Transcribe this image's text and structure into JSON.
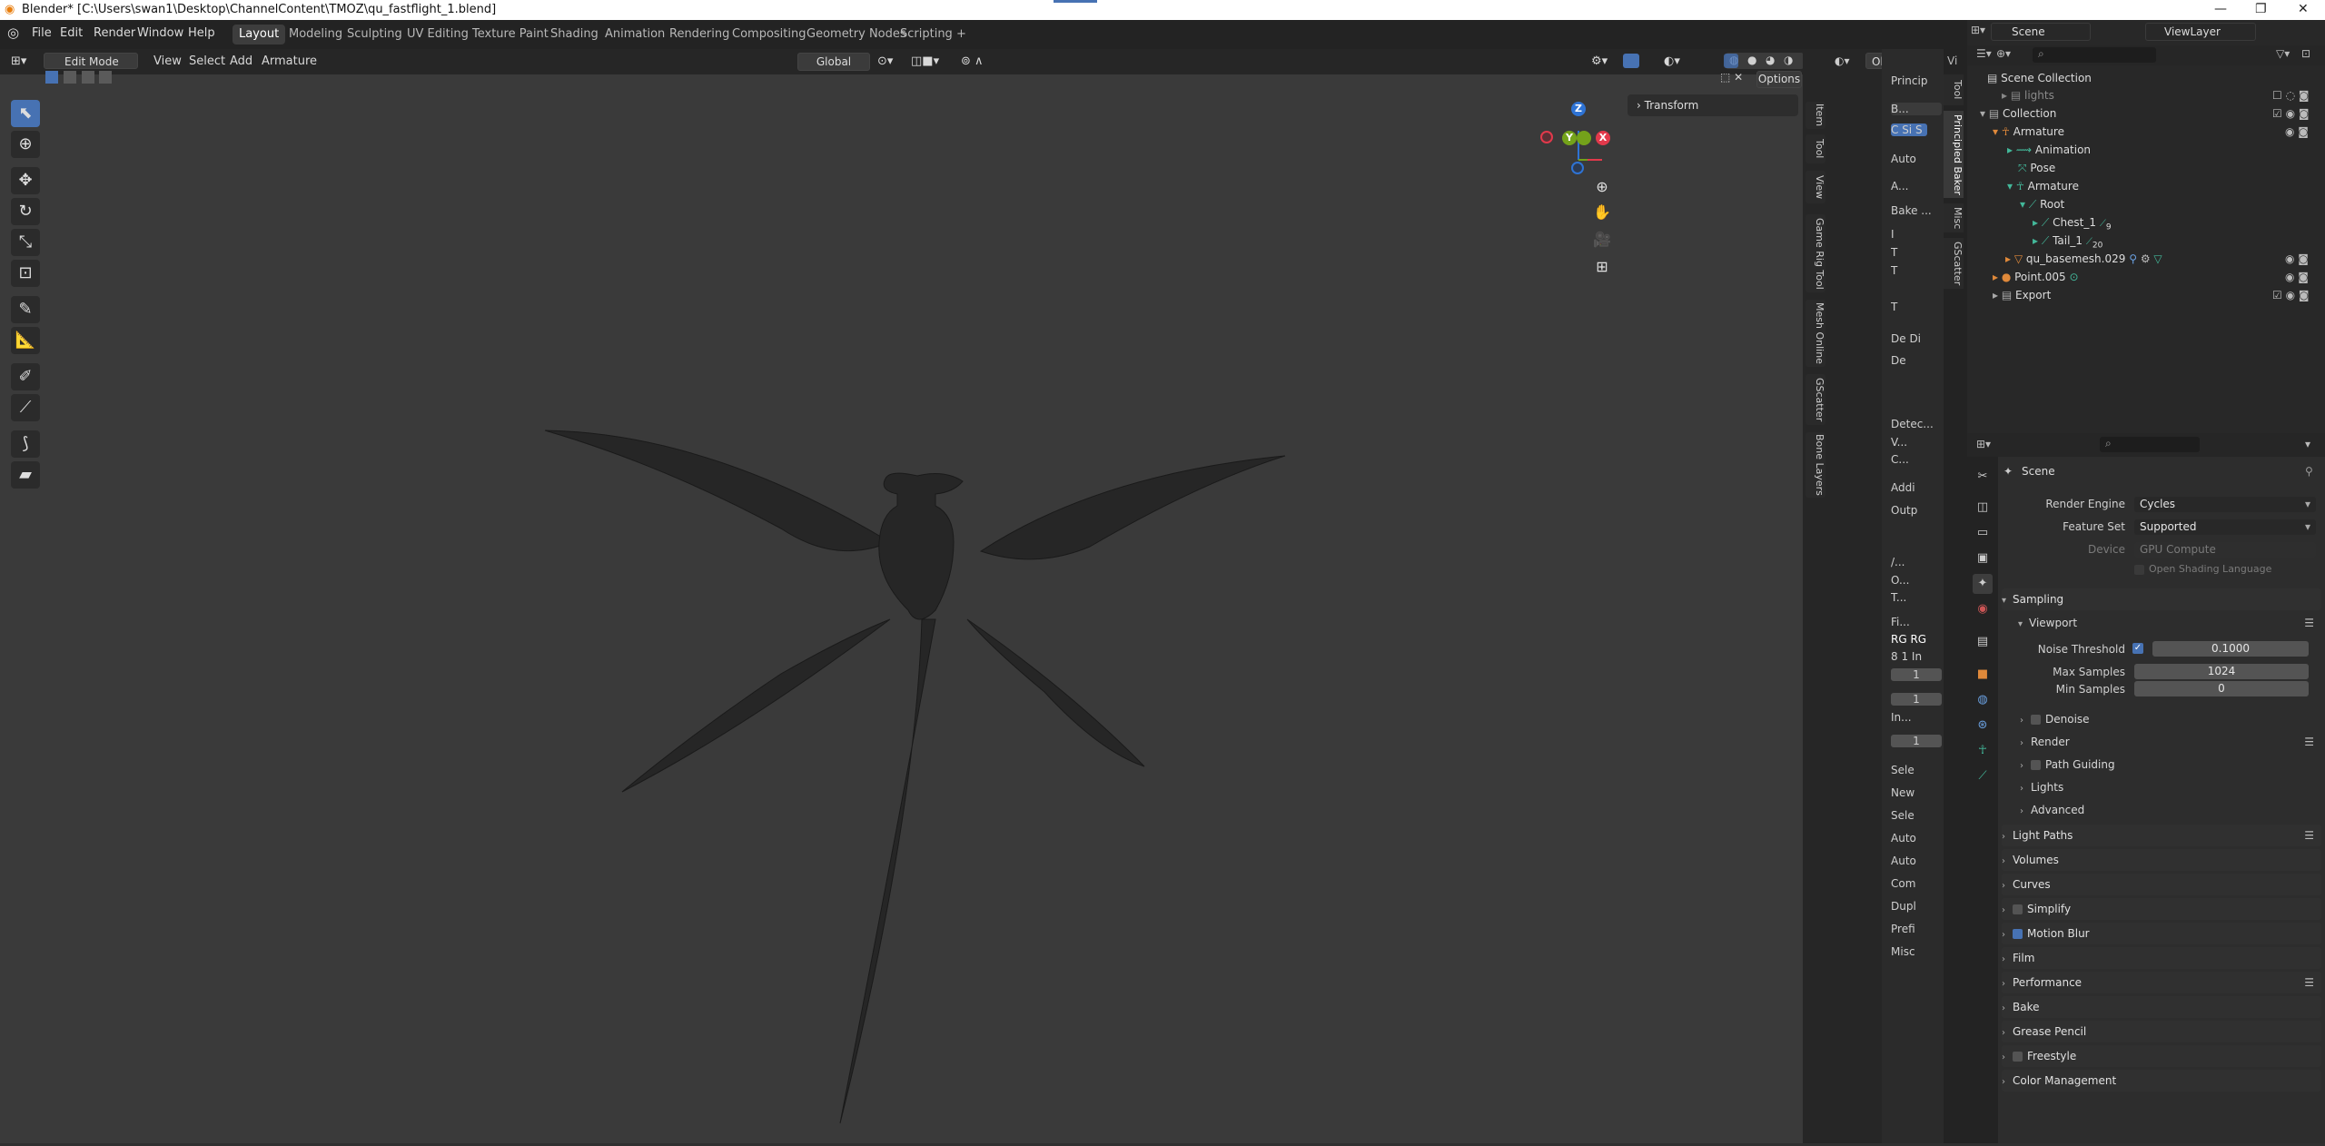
{
  "title_bar": {
    "text": "Blender* [C:\\Users\\swan1\\Desktop\\ChannelContent\\TMOZ\\qu_fastflight_1.blend]",
    "minimize": "—",
    "maximize": "❐",
    "close": "✕"
  },
  "menu": {
    "items": [
      "File",
      "Edit",
      "Render",
      "Window",
      "Help"
    ]
  },
  "workspaces": {
    "tabs": [
      "Layout",
      "Modeling",
      "Sculpting",
      "UV Editing",
      "Texture Paint",
      "Shading",
      "Animation",
      "Rendering",
      "Compositing",
      "Geometry Nodes",
      "Scripting"
    ],
    "active": "Layout",
    "add": "+"
  },
  "viewport_header": {
    "mode": "Edit Mode",
    "menus": [
      "View",
      "Select",
      "Add",
      "Armature"
    ],
    "orientation": "Global",
    "options": "Options",
    "object": "Object",
    "vi": "Vi"
  },
  "gizmo": {
    "z": "Z",
    "y": "Y",
    "x": "X"
  },
  "npanel": {
    "transform": "Transform",
    "tabs": [
      "Item",
      "Tool",
      "View",
      "Game Rig Tool",
      "Mesh Online",
      "GScatter",
      "Bone Layers"
    ]
  },
  "mid_tabs": [
    "Tool",
    "Principled Baker",
    "Misc",
    "GScatter"
  ],
  "baker": {
    "rows": [
      "Princip",
      "B...",
      "C  Si  S",
      "Auto",
      "A...",
      "Bake ...",
      "I",
      "T",
      "T",
      "T",
      "De  Di",
      "De",
      "Detec...",
      "V...",
      "C...",
      "Addi",
      "Outp",
      "/...",
      "O...",
      "T...",
      "Fi...",
      "RG  RG",
      "8  1  In",
      "1",
      "1",
      "In...",
      "1",
      "Sele",
      "New",
      "Sele",
      "Auto",
      "Auto",
      "Com",
      "Dupl",
      "Prefi",
      "Misc"
    ]
  },
  "outliner": {
    "scene": "Scene",
    "viewlayer": "ViewLayer",
    "rows": [
      {
        "label": "Scene Collection"
      },
      {
        "label": "lights"
      },
      {
        "label": "Collection"
      },
      {
        "label": "Armature"
      },
      {
        "label": "Animation"
      },
      {
        "label": "Pose"
      },
      {
        "label": "Armature"
      },
      {
        "label": "Root"
      },
      {
        "label": "Chest_1",
        "badge": "9"
      },
      {
        "label": "Tail_1",
        "badge": "20"
      },
      {
        "label": "qu_basemesh.029"
      },
      {
        "label": "Point.005"
      },
      {
        "label": "Export"
      }
    ]
  },
  "properties": {
    "context": "Scene",
    "render_engine_label": "Render Engine",
    "render_engine": "Cycles",
    "feature_set_label": "Feature Set",
    "feature_set": "Supported",
    "device_label": "Device",
    "device": "GPU Compute",
    "osl": "Open Shading Language",
    "sampling": "Sampling",
    "viewport": "Viewport",
    "noise_threshold_label": "Noise Threshold",
    "noise_threshold": "0.1000",
    "max_samples_label": "Max Samples",
    "max_samples": "1024",
    "min_samples_label": "Min Samples",
    "min_samples": "0",
    "sub_sections": [
      "Denoise",
      "Render",
      "Path Guiding",
      "Lights",
      "Advanced"
    ],
    "sections": [
      "Light Paths",
      "Volumes",
      "Curves",
      "Simplify",
      "Motion Blur",
      "Film",
      "Performance",
      "Bake",
      "Grease Pencil",
      "Freestyle",
      "Color Management"
    ]
  },
  "colors": {
    "accent": "#4772b3",
    "gizmo_x": "#e2394b",
    "gizmo_y": "#74a21a",
    "gizmo_z": "#2e73d4",
    "bone": "#43b89a",
    "object": "#e0893a"
  }
}
